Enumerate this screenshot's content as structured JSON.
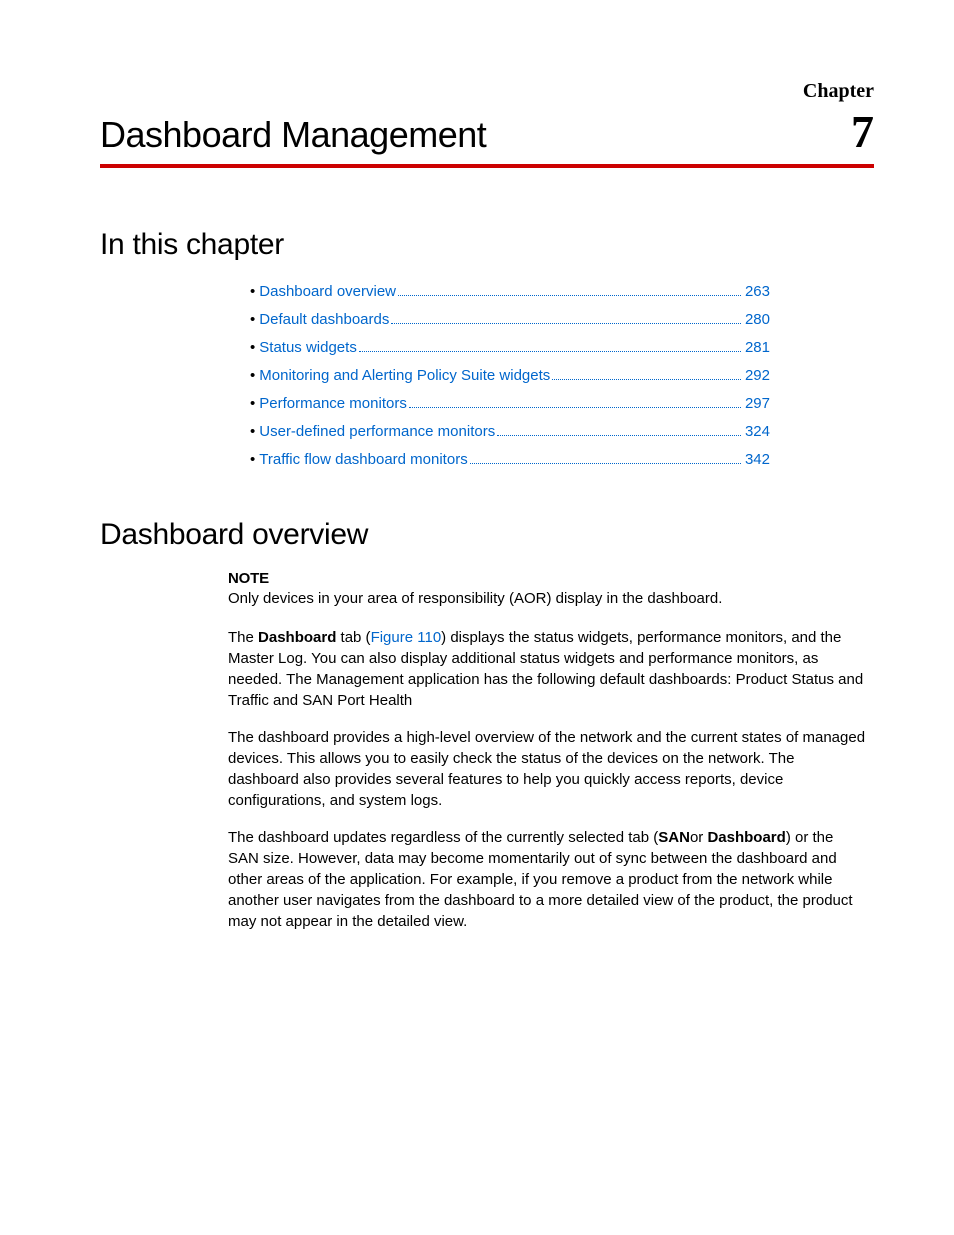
{
  "header": {
    "chapter_label": "Chapter",
    "chapter_title": "Dashboard Management",
    "chapter_number": "7"
  },
  "sections": {
    "in_this_chapter": "In this chapter",
    "dashboard_overview": "Dashboard overview"
  },
  "toc": [
    {
      "label": "Dashboard overview",
      "page": "263"
    },
    {
      "label": "Default dashboards",
      "page": "280"
    },
    {
      "label": "Status widgets",
      "page": "281"
    },
    {
      "label": "Monitoring and Alerting Policy Suite widgets",
      "page": "292"
    },
    {
      "label": "Performance monitors",
      "page": "297"
    },
    {
      "label": "User-defined performance monitors",
      "page": "324"
    },
    {
      "label": "Traffic flow dashboard monitors",
      "page": "342"
    }
  ],
  "note": {
    "label": "NOTE",
    "text": "Only devices in your area of responsibility (AOR) display in the dashboard."
  },
  "body": {
    "p1_pre": "The ",
    "p1_bold1": "Dashboard",
    "p1_mid1": " tab (",
    "p1_link": "Figure 110",
    "p1_post": ") displays the status widgets, performance monitors, and the Master Log. You can also display additional status widgets and performance monitors, as needed. The Management application has the following default dashboards: Product Status and Traffic and SAN Port Health",
    "p2": "The dashboard provides a high-level overview of the network and the current states of managed devices. This allows you to easily check the status of the devices on the network. The dashboard also provides several features to help you quickly access reports, device configurations, and system logs.",
    "p3_pre": "The dashboard updates regardless of the currently selected tab (",
    "p3_bold1": "SAN",
    "p3_mid": "or ",
    "p3_bold2": "Dashboard",
    "p3_post": ") or the SAN size. However, data may become momentarily out of sync between the dashboard and other areas of the application. For example, if you remove a product from the network while another user navigates from the dashboard to a more detailed view of the product, the product may not appear in the detailed view."
  }
}
